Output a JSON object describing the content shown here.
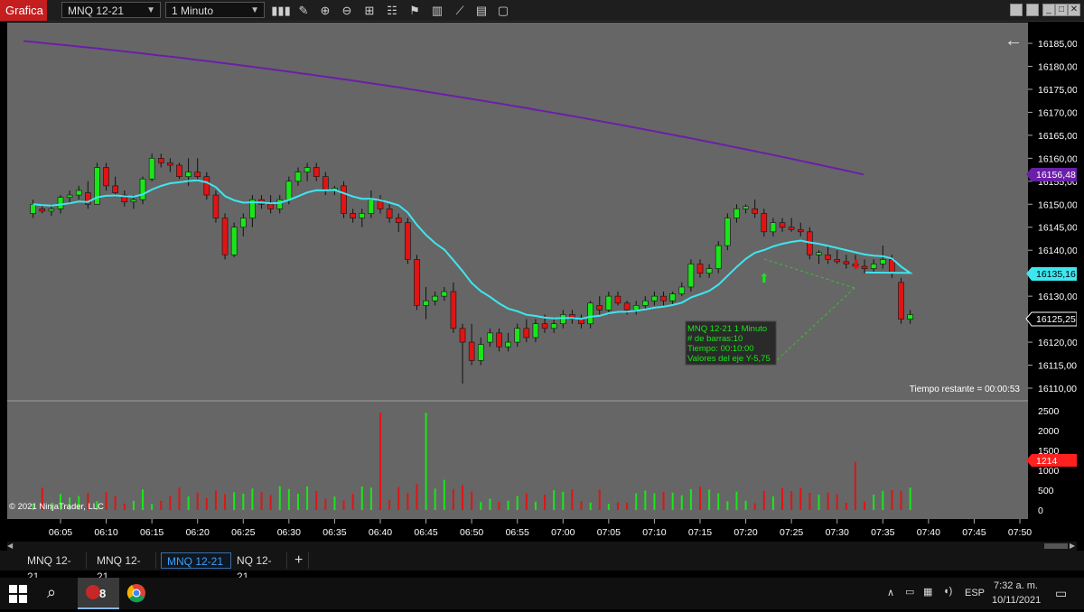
{
  "window": {
    "title": "Grafica",
    "instrument": "MNQ 12-21",
    "interval": "1 Minuto",
    "toolbar_icons": [
      "bar-chart-icon",
      "pencil-icon",
      "zoom-in-icon",
      "zoom-out-icon",
      "crosshair-icon",
      "properties-icon",
      "strategy-icon",
      "indicator-icon",
      "drawing-tool-icon",
      "template-icon",
      "notes-icon"
    ]
  },
  "chart": {
    "price_labels": [
      "16185,00",
      "16180,00",
      "16175,00",
      "16170,00",
      "16165,00",
      "16160,00",
      "16155,00",
      "16150,00",
      "16145,00",
      "16140,00",
      "16135,00",
      "16130,00",
      "16125,00",
      "16120,00",
      "16115,00",
      "16110,00"
    ],
    "marker_labels": {
      "slow_ma": "16156,48",
      "fast_ma": "16135,16",
      "last_price": "16125,25"
    },
    "marker_colors": {
      "slow_ma": "#6a1fa8",
      "fast_ma": "#3ee6f0",
      "last_price": "#000000",
      "volume_last": "#ff2020"
    },
    "volume_labels": [
      "2500",
      "2000",
      "1500",
      "1000",
      "500",
      "0"
    ],
    "volume_last": "1214",
    "time_labels": [
      "06:05",
      "06:10",
      "06:15",
      "06:20",
      "06:25",
      "06:30",
      "06:35",
      "06:40",
      "06:45",
      "06:50",
      "06:55",
      "07:00",
      "07:05",
      "07:10",
      "07:15",
      "07:20",
      "07:25",
      "07:30",
      "07:35",
      "07:40",
      "07:45",
      "07:50"
    ],
    "remaining_time": "Tiempo restante = 00:00:53",
    "copyright": "© 2021 NinjaTrader, LLC",
    "measure_box": {
      "line1": "MNQ 12-21 1 Minuto",
      "line2": "# de barras:10",
      "line3": "Tiempo:    00:10:00",
      "line4": "Valores del eje Y-5,75"
    },
    "colors": {
      "background": "#666666",
      "up": "#19e619",
      "down": "#e01414",
      "slow_ma": "#6a1fa8",
      "fast_ma": "#3ee6f0"
    }
  },
  "tabs": [
    "MNQ 12-21",
    "MNQ 12-21",
    "MNQ 12-21",
    "NQ 12-21",
    "+"
  ],
  "active_tab": 2,
  "taskbar": {
    "clock_time": "7:32 a. m.",
    "clock_date": "10/11/2021",
    "language": "ESP",
    "apps": [
      "windows-icon",
      "search-icon",
      "ninjatrader-icon",
      "chrome-icon"
    ],
    "ninja_badge": "8"
  },
  "chart_data": {
    "type": "candlestick",
    "title": "MNQ 12-21 1 Minuto",
    "x_range": [
      "06:02",
      "07:52"
    ],
    "y_range": [
      16108.5,
      16189
    ],
    "candles": [
      {
        "o": 16148,
        "h": 16151,
        "l": 16147,
        "c": 16150
      },
      {
        "o": 16149,
        "h": 16150,
        "l": 16148,
        "c": 16148.5
      },
      {
        "o": 16148.5,
        "h": 16150,
        "l": 16147.5,
        "c": 16149
      },
      {
        "o": 16149,
        "h": 16152,
        "l": 16148,
        "c": 16151.5
      },
      {
        "o": 16151.5,
        "h": 16153,
        "l": 16150,
        "c": 16152
      },
      {
        "o": 16152,
        "h": 16154,
        "l": 16151,
        "c": 16153
      },
      {
        "o": 16152.5,
        "h": 16155,
        "l": 16149,
        "c": 16150
      },
      {
        "o": 16150,
        "h": 16159,
        "l": 16150,
        "c": 16158
      },
      {
        "o": 16158,
        "h": 16159,
        "l": 16153,
        "c": 16154
      },
      {
        "o": 16154,
        "h": 16156,
        "l": 16152,
        "c": 16152.5
      },
      {
        "o": 16152,
        "h": 16153,
        "l": 16149.5,
        "c": 16150.5
      },
      {
        "o": 16150.5,
        "h": 16152,
        "l": 16149,
        "c": 16151
      },
      {
        "o": 16151,
        "h": 16156,
        "l": 16150,
        "c": 16155.5
      },
      {
        "o": 16155.5,
        "h": 16161,
        "l": 16155,
        "c": 16160
      },
      {
        "o": 16160,
        "h": 16161,
        "l": 16158,
        "c": 16159
      },
      {
        "o": 16159,
        "h": 16160,
        "l": 16157,
        "c": 16158.5
      },
      {
        "o": 16158.5,
        "h": 16159,
        "l": 16155.5,
        "c": 16156
      },
      {
        "o": 16156,
        "h": 16160,
        "l": 16154,
        "c": 16157
      },
      {
        "o": 16157,
        "h": 16160,
        "l": 16155,
        "c": 16156
      },
      {
        "o": 16156,
        "h": 16157,
        "l": 16151,
        "c": 16152
      },
      {
        "o": 16152,
        "h": 16153,
        "l": 16146,
        "c": 16147
      },
      {
        "o": 16147,
        "h": 16148,
        "l": 16138,
        "c": 16139
      },
      {
        "o": 16139,
        "h": 16146,
        "l": 16138.5,
        "c": 16145
      },
      {
        "o": 16145,
        "h": 16148,
        "l": 16143,
        "c": 16147
      },
      {
        "o": 16147,
        "h": 16152,
        "l": 16145,
        "c": 16151
      },
      {
        "o": 16151,
        "h": 16152,
        "l": 16149,
        "c": 16150
      },
      {
        "o": 16150,
        "h": 16152,
        "l": 16148,
        "c": 16149
      },
      {
        "o": 16149,
        "h": 16152,
        "l": 16148,
        "c": 16151
      },
      {
        "o": 16151,
        "h": 16156,
        "l": 16150,
        "c": 16155
      },
      {
        "o": 16155,
        "h": 16158,
        "l": 16154,
        "c": 16157
      },
      {
        "o": 16157,
        "h": 16159,
        "l": 16155,
        "c": 16158
      },
      {
        "o": 16158,
        "h": 16159,
        "l": 16155,
        "c": 16156
      },
      {
        "o": 16156,
        "h": 16157,
        "l": 16152,
        "c": 16153
      },
      {
        "o": 16153,
        "h": 16154,
        "l": 16152,
        "c": 16153.5
      },
      {
        "o": 16154,
        "h": 16155,
        "l": 16147,
        "c": 16148
      },
      {
        "o": 16148,
        "h": 16149,
        "l": 16146,
        "c": 16147
      },
      {
        "o": 16147,
        "h": 16149,
        "l": 16145,
        "c": 16148
      },
      {
        "o": 16148,
        "h": 16153,
        "l": 16147,
        "c": 16151
      },
      {
        "o": 16151,
        "h": 16152,
        "l": 16148,
        "c": 16149
      },
      {
        "o": 16149,
        "h": 16150,
        "l": 16146,
        "c": 16147
      },
      {
        "o": 16147,
        "h": 16148,
        "l": 16144,
        "c": 16146
      },
      {
        "o": 16146,
        "h": 16147,
        "l": 16137,
        "c": 16138
      },
      {
        "o": 16138,
        "h": 16139,
        "l": 16127,
        "c": 16128
      },
      {
        "o": 16128,
        "h": 16132,
        "l": 16125,
        "c": 16129
      },
      {
        "o": 16129,
        "h": 16131,
        "l": 16128,
        "c": 16130
      },
      {
        "o": 16130,
        "h": 16132,
        "l": 16129,
        "c": 16131
      },
      {
        "o": 16131,
        "h": 16133,
        "l": 16122,
        "c": 16123
      },
      {
        "o": 16123,
        "h": 16124,
        "l": 16111,
        "c": 16120
      },
      {
        "o": 16120,
        "h": 16124,
        "l": 16115,
        "c": 16116
      },
      {
        "o": 16116,
        "h": 16121,
        "l": 16115,
        "c": 16119.5
      },
      {
        "o": 16120,
        "h": 16123,
        "l": 16119,
        "c": 16122
      },
      {
        "o": 16122,
        "h": 16123,
        "l": 16118,
        "c": 16119
      },
      {
        "o": 16119,
        "h": 16122,
        "l": 16118,
        "c": 16120
      },
      {
        "o": 16120,
        "h": 16124,
        "l": 16119,
        "c": 16123
      },
      {
        "o": 16123,
        "h": 16125,
        "l": 16120,
        "c": 16121
      },
      {
        "o": 16121,
        "h": 16125,
        "l": 16120,
        "c": 16124
      },
      {
        "o": 16124,
        "h": 16126,
        "l": 16122,
        "c": 16123
      },
      {
        "o": 16123,
        "h": 16125,
        "l": 16122,
        "c": 16124
      },
      {
        "o": 16124,
        "h": 16127,
        "l": 16123,
        "c": 16126
      },
      {
        "o": 16126,
        "h": 16127,
        "l": 16124,
        "c": 16125
      },
      {
        "o": 16125,
        "h": 16126,
        "l": 16123,
        "c": 16124
      },
      {
        "o": 16124,
        "h": 16129,
        "l": 16123,
        "c": 16128.5
      },
      {
        "o": 16128,
        "h": 16130,
        "l": 16126,
        "c": 16127
      },
      {
        "o": 16127,
        "h": 16131,
        "l": 16126,
        "c": 16130
      },
      {
        "o": 16130,
        "h": 16131,
        "l": 16128,
        "c": 16128.5
      },
      {
        "o": 16128.5,
        "h": 16129,
        "l": 16126,
        "c": 16127
      },
      {
        "o": 16127,
        "h": 16129,
        "l": 16126,
        "c": 16128
      },
      {
        "o": 16128,
        "h": 16130,
        "l": 16127,
        "c": 16129
      },
      {
        "o": 16129,
        "h": 16131,
        "l": 16128,
        "c": 16130
      },
      {
        "o": 16130,
        "h": 16131,
        "l": 16128,
        "c": 16129
      },
      {
        "o": 16129,
        "h": 16131,
        "l": 16128,
        "c": 16130.5
      },
      {
        "o": 16130.5,
        "h": 16133,
        "l": 16130,
        "c": 16132
      },
      {
        "o": 16132,
        "h": 16138,
        "l": 16131,
        "c": 16137
      },
      {
        "o": 16137,
        "h": 16138,
        "l": 16134,
        "c": 16135
      },
      {
        "o": 16135,
        "h": 16137,
        "l": 16134,
        "c": 16136
      },
      {
        "o": 16136,
        "h": 16142,
        "l": 16135,
        "c": 16141
      },
      {
        "o": 16141,
        "h": 16148,
        "l": 16140,
        "c": 16147
      },
      {
        "o": 16147,
        "h": 16150,
        "l": 16146,
        "c": 16149
      },
      {
        "o": 16149,
        "h": 16150,
        "l": 16148,
        "c": 16149.5
      },
      {
        "o": 16149,
        "h": 16151,
        "l": 16147,
        "c": 16148
      },
      {
        "o": 16148,
        "h": 16149,
        "l": 16143,
        "c": 16144
      },
      {
        "o": 16144,
        "h": 16147,
        "l": 16143,
        "c": 16146
      },
      {
        "o": 16146,
        "h": 16147,
        "l": 16144,
        "c": 16145
      },
      {
        "o": 16145,
        "h": 16147,
        "l": 16144,
        "c": 16144.5
      },
      {
        "o": 16144.5,
        "h": 16146,
        "l": 16143,
        "c": 16144
      },
      {
        "o": 16144,
        "h": 16145,
        "l": 16138,
        "c": 16139
      },
      {
        "o": 16139,
        "h": 16140,
        "l": 16137,
        "c": 16139.5
      },
      {
        "o": 16139,
        "h": 16141,
        "l": 16137,
        "c": 16138
      },
      {
        "o": 16138,
        "h": 16140,
        "l": 16137,
        "c": 16137.5
      },
      {
        "o": 16137.5,
        "h": 16139,
        "l": 16136,
        "c": 16137
      },
      {
        "o": 16137,
        "h": 16139,
        "l": 16136,
        "c": 16136.5
      },
      {
        "o": 16136.5,
        "h": 16138,
        "l": 16135,
        "c": 16136
      },
      {
        "o": 16136,
        "h": 16138,
        "l": 16135,
        "c": 16137
      },
      {
        "o": 16137,
        "h": 16141,
        "l": 16136,
        "c": 16138
      },
      {
        "o": 16138,
        "h": 16139,
        "l": 16134,
        "c": 16135
      },
      {
        "o": 16133,
        "h": 16134,
        "l": 16124,
        "c": 16125
      },
      {
        "o": 16125,
        "h": 16127,
        "l": 16124,
        "c": 16126
      }
    ],
    "slow_ma_end": 16156.48,
    "fast_ma_end": 16135.16,
    "last_price": 16125.25,
    "volume": {
      "last": 1214,
      "spikes": [
        {
          "time": "06:40",
          "value": 2450
        },
        {
          "time": "06:45",
          "value": 2450
        },
        {
          "time": "07:32",
          "value": 1214
        }
      ]
    }
  }
}
